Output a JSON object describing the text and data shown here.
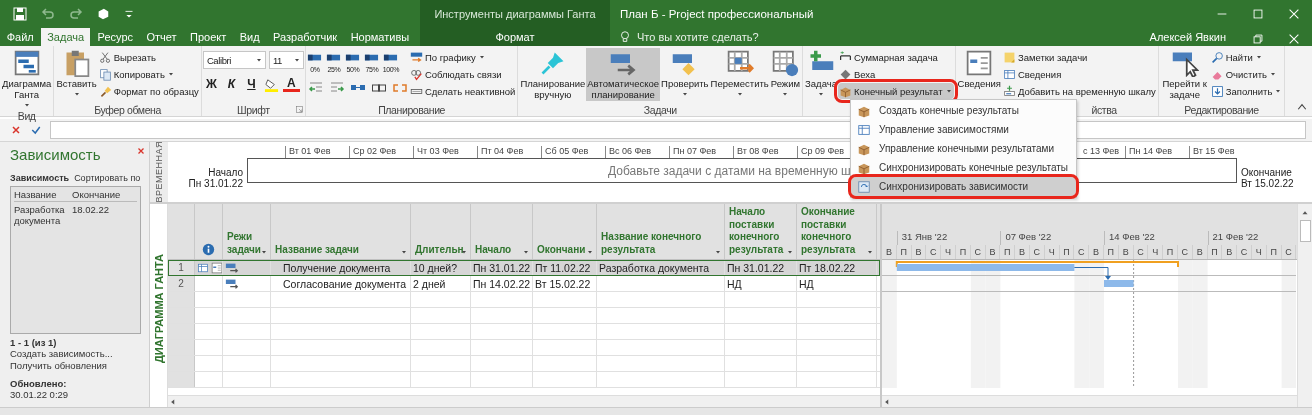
{
  "window": {
    "title": "План Б - Project профессиональный",
    "context_group": "Инструменты диаграммы Ганта",
    "user": "Алексей Явкин"
  },
  "tabs": [
    {
      "label": "Файл",
      "selected": false,
      "kind": "file"
    },
    {
      "label": "Задача",
      "selected": true,
      "kind": "main"
    },
    {
      "label": "Ресурс",
      "selected": false,
      "kind": "main"
    },
    {
      "label": "Отчет",
      "selected": false,
      "kind": "main"
    },
    {
      "label": "Проект",
      "selected": false,
      "kind": "main"
    },
    {
      "label": "Вид",
      "selected": false,
      "kind": "main"
    },
    {
      "label": "Разработчик",
      "selected": false,
      "kind": "main"
    },
    {
      "label": "Нормативы",
      "selected": false,
      "kind": "main"
    },
    {
      "label": "Формат",
      "selected": false,
      "kind": "context"
    }
  ],
  "search": {
    "placeholder": "Что вы хотите сделать?"
  },
  "ribbon": [
    {
      "label": "Вид",
      "kind": "standard",
      "controls": [
        {
          "kind": "large",
          "label": "Диаграмма Ганта",
          "dropdown": true
        }
      ]
    },
    {
      "label": "Буфер обмена",
      "kind": "standard",
      "controls": [
        {
          "kind": "large",
          "label": "Вставить",
          "dropdown": true
        },
        {
          "kind": "small",
          "label": "Вырезать",
          "dropdown": false
        },
        {
          "kind": "small",
          "label": "Копировать",
          "dropdown": true
        },
        {
          "kind": "small",
          "label": "Формат по образцу",
          "dropdown": false
        }
      ]
    },
    {
      "label": "Шрифт",
      "kind": "font",
      "font": "Calibri",
      "size": "11",
      "styles": [
        "Ж",
        "К",
        "Ч"
      ],
      "color_glyph": "A"
    },
    {
      "label": "Планирование",
      "kind": "schedule",
      "percents": [
        "0%",
        "25%",
        "50%",
        "75%",
        "100%"
      ],
      "controls": [
        {
          "kind": "small",
          "label": "По графику",
          "dropdown": true
        },
        {
          "kind": "small",
          "label": "Соблюдать связи",
          "dropdown": false
        },
        {
          "kind": "small",
          "label": "Сделать неактивной",
          "dropdown": false
        }
      ]
    },
    {
      "label": "Задачи",
      "kind": "standard",
      "controls": [
        {
          "kind": "large",
          "label": "Планирование вручную",
          "dropdown": false,
          "selected": false
        },
        {
          "kind": "large",
          "label": "Автоматическое планирование",
          "dropdown": false,
          "selected": true
        },
        {
          "kind": "large",
          "label": "Проверить",
          "dropdown": true
        },
        {
          "kind": "large",
          "label": "Переместить",
          "dropdown": true
        },
        {
          "kind": "large",
          "label": "Режим",
          "dropdown": true
        }
      ]
    },
    {
      "kind": "standard",
      "controls": [
        {
          "kind": "large",
          "label": "Задача",
          "dropdown": true
        },
        {
          "kind": "small",
          "label": "Суммарная задача",
          "dropdown": false
        },
        {
          "kind": "small",
          "label": "Веха",
          "dropdown": false
        },
        {
          "kind": "small",
          "label": "Конечный результат",
          "dropdown": true,
          "highlighted": true
        }
      ]
    },
    {
      "label": "йства",
      "kind": "standard",
      "controls": [
        {
          "kind": "large",
          "label": "Сведения",
          "dropdown": false
        },
        {
          "kind": "small",
          "label": "Заметки задачи",
          "dropdown": false
        },
        {
          "kind": "small",
          "label": "Сведения",
          "dropdown": false
        },
        {
          "kind": "small",
          "label": "Добавить на временную шкалу",
          "dropdown": false
        }
      ]
    },
    {
      "label": "Редактирование",
      "kind": "standard",
      "controls": [
        {
          "kind": "large",
          "label": "Перейти к задаче",
          "dropdown": false
        },
        {
          "kind": "small",
          "label": "Найти",
          "dropdown": true
        },
        {
          "kind": "small",
          "label": "Очистить",
          "dropdown": true
        },
        {
          "kind": "small",
          "label": "Заполнить",
          "dropdown": true
        }
      ]
    }
  ],
  "deliverable_menu": {
    "items": [
      {
        "label": "Создать конечные результаты",
        "selected": false,
        "highlighted": false
      },
      {
        "label": "Управление зависимостями",
        "selected": false,
        "highlighted": false
      },
      {
        "label": "Управление конечными результатами",
        "selected": false,
        "highlighted": false
      },
      {
        "label": "Синхронизировать конечные результаты",
        "selected": false,
        "highlighted": false
      },
      {
        "label": "Синхронизировать зависимости",
        "selected": true,
        "highlighted": true
      }
    ]
  },
  "dependency_pane": {
    "title": "Зависимость",
    "sort_label": "Зависимость",
    "sort_by": "Сортировать по",
    "columns": [
      "Название",
      "Окончание"
    ],
    "items": [
      {
        "name": "Разработка документа",
        "finish": "18.02.22"
      }
    ],
    "count": "1 - 1 (из 1)",
    "links": [
      "Создать зависимость...",
      "Получить обновления"
    ],
    "updated_label": "Обновлено:",
    "updated": "30.01.22 0:29"
  },
  "timeline": {
    "side_label": "ВРЕМЕННАЯ",
    "start_label": "Начало",
    "start": "Пн 31.01.22",
    "finish_label": "Окончание",
    "finish": "Вт 15.02.22",
    "dates_before_menu": [
      "Вт 01 Фев",
      "Ср 02 Фев",
      "Чт 03 Фев",
      "Пт 04 Фев",
      "Сб 05 Фев",
      "Вс 06 Фев",
      "Пн 07 Фев",
      "Вт 08 Фев",
      "Ср 09 Фев"
    ],
    "dates_after_menu": [
      "с 13 Фев",
      "Пн 14 Фев",
      "Вт 15 Фев"
    ],
    "message": "Добавьте задачи с датами на временную ш"
  },
  "gantt_table": {
    "side_label": "ДИАГРАММА ГАНТА",
    "columns": [
      {
        "kind": "info"
      },
      {
        "kind": "text",
        "label": "Режи задачи"
      },
      {
        "kind": "text",
        "label": "Название задачи"
      },
      {
        "kind": "text",
        "label": "Длительн"
      },
      {
        "kind": "text",
        "label": "Начало"
      },
      {
        "kind": "text",
        "label": "Окончани"
      },
      {
        "kind": "text",
        "label": "Название конечного результата"
      },
      {
        "kind": "text",
        "label": "Начало поставки конечного результата"
      },
      {
        "kind": "text",
        "label": "Окончание поставки конечного результата"
      }
    ],
    "rows": [
      {
        "id": "1",
        "selected": true,
        "indicators": true,
        "name": "Получение документа",
        "duration": "10 дней?",
        "start": "Пн 31.01.22",
        "finish": "Пт 11.02.22",
        "deliverable": "Разработка документа",
        "deliverable_start": "Пн 31.01.22",
        "deliverable_finish": "Пт 18.02.22"
      },
      {
        "id": "2",
        "selected": false,
        "indicators": false,
        "name": "Согласование документа",
        "duration": "2 дней",
        "start": "Пн 14.02.22",
        "finish": "Вт 15.02.22",
        "deliverable_start": "НД",
        "deliverable_finish": "НД"
      }
    ]
  },
  "gantt_chart": {
    "weeks": [
      "31 Янв '22",
      "07 Фев '22",
      "14 Фев '22",
      "21 Фев '22"
    ],
    "days": [
      "В",
      "П",
      "В",
      "С",
      "Ч",
      "П",
      "С",
      "В",
      "П",
      "В",
      "С",
      "Ч",
      "П",
      "С",
      "В",
      "П",
      "В",
      "С",
      "Ч",
      "П",
      "С",
      "В",
      "П",
      "В",
      "С",
      "Ч",
      "П",
      "С"
    ]
  }
}
